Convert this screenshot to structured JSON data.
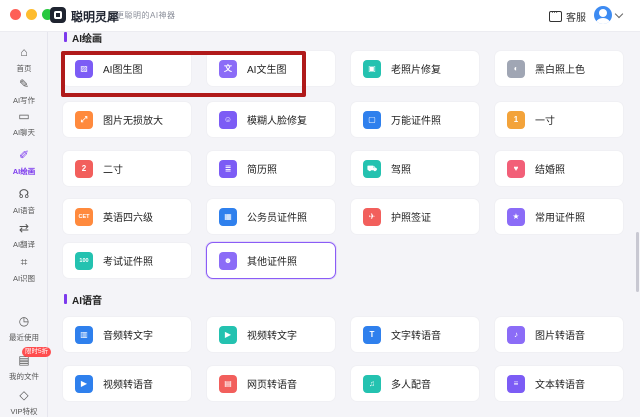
{
  "app": {
    "name": "聪明灵犀",
    "slogan": "更聪明的AI神器",
    "service_label": "客服"
  },
  "sidebar": {
    "items": [
      {
        "label": "首页",
        "icon": "home-icon",
        "glyph": "⌂",
        "active": false
      },
      {
        "label": "AI写作",
        "icon": "pen-icon",
        "glyph": "✎",
        "active": false
      },
      {
        "label": "AI聊天",
        "icon": "chat-icon",
        "glyph": "▭",
        "active": false
      },
      {
        "label": "AI绘画",
        "icon": "brush-icon",
        "glyph": "✐",
        "active": true
      },
      {
        "label": "AI语音",
        "icon": "headphone-icon",
        "glyph": "☊",
        "active": false
      },
      {
        "label": "AI翻译",
        "icon": "translate-icon",
        "glyph": "⇄",
        "active": false
      },
      {
        "label": "AI识图",
        "icon": "scan-icon",
        "glyph": "⌗",
        "active": false
      },
      {
        "label": "最近使用",
        "icon": "clock-icon",
        "glyph": "◷",
        "active": false
      },
      {
        "label": "我的文件",
        "icon": "file-icon",
        "glyph": "▤",
        "active": false
      },
      {
        "label": "VIP特权",
        "icon": "diamond-icon",
        "glyph": "◇",
        "active": false
      }
    ],
    "vip_badge": "限时5折"
  },
  "sections": [
    {
      "title": "AI绘画",
      "cards": [
        {
          "label": "AI图生图",
          "icon": "image-to-image-icon",
          "color": "#7c5cf5",
          "glyph": "▨"
        },
        {
          "label": "AI文生图",
          "icon": "text-to-image-icon",
          "color": "#8b6cf7",
          "glyph": "文"
        },
        {
          "label": "老照片修复",
          "icon": "photo-restore-icon",
          "color": "#24c2b0",
          "glyph": "▣"
        },
        {
          "label": "黑白照上色",
          "icon": "colorize-icon",
          "color": "#a0a6b4",
          "glyph": "◐"
        },
        {
          "label": "图片无损放大",
          "icon": "upscale-icon",
          "color": "#ff8a3d",
          "glyph": "⤢"
        },
        {
          "label": "模糊人脸修复",
          "icon": "face-restore-icon",
          "color": "#7c5cf5",
          "glyph": "☺"
        },
        {
          "label": "万能证件照",
          "icon": "id-photo-icon",
          "color": "#2f80ed",
          "glyph": "▢"
        },
        {
          "label": "一寸",
          "icon": "one-inch-icon",
          "color": "#f3a33a",
          "glyph": "1"
        },
        {
          "label": "二寸",
          "icon": "two-inch-icon",
          "color": "#f25f5c",
          "glyph": "2"
        },
        {
          "label": "简历照",
          "icon": "resume-icon",
          "color": "#7c5cf5",
          "glyph": "≣"
        },
        {
          "label": "驾照",
          "icon": "driver-license-icon",
          "color": "#24c2b0",
          "glyph": "⛟"
        },
        {
          "label": "结婚照",
          "icon": "wedding-icon",
          "color": "#f25f78",
          "glyph": "♥"
        },
        {
          "label": "英语四六级",
          "icon": "cet-icon",
          "color": "#ff8a3d",
          "glyph": "CET"
        },
        {
          "label": "公务员证件照",
          "icon": "civil-servant-icon",
          "color": "#2f80ed",
          "glyph": "▦"
        },
        {
          "label": "护照签证",
          "icon": "passport-icon",
          "color": "#f25f5c",
          "glyph": "✈"
        },
        {
          "label": "常用证件照",
          "icon": "common-id-icon",
          "color": "#8b6cf7",
          "glyph": "★"
        },
        {
          "label": "考试证件照",
          "icon": "exam-photo-icon",
          "color": "#24c2b0",
          "glyph": "100"
        },
        {
          "label": "其他证件照",
          "icon": "other-id-icon",
          "color": "#8b6cf7",
          "glyph": "☻"
        }
      ]
    },
    {
      "title": "AI语音",
      "cards": [
        {
          "label": "音频转文字",
          "icon": "audio-to-text-icon",
          "color": "#2f80ed",
          "glyph": "▥"
        },
        {
          "label": "视频转文字",
          "icon": "video-to-text-icon",
          "color": "#24c2b0",
          "glyph": "▶"
        },
        {
          "label": "文字转语音",
          "icon": "text-to-speech-icon",
          "color": "#2f80ed",
          "glyph": "T"
        },
        {
          "label": "图片转语音",
          "icon": "image-to-speech-icon",
          "color": "#8b6cf7",
          "glyph": "♪"
        },
        {
          "label": "视频转语音",
          "icon": "video-to-speech-icon",
          "color": "#2f80ed",
          "glyph": "▶"
        },
        {
          "label": "网页转语音",
          "icon": "web-to-speech-icon",
          "color": "#f25f5c",
          "glyph": "▤"
        },
        {
          "label": "多人配音",
          "icon": "multi-voice-icon",
          "color": "#24c2b0",
          "glyph": "♫"
        },
        {
          "label": "文本转语音",
          "icon": "doc-to-speech-icon",
          "color": "#7c5cf5",
          "glyph": "≡"
        }
      ]
    }
  ]
}
